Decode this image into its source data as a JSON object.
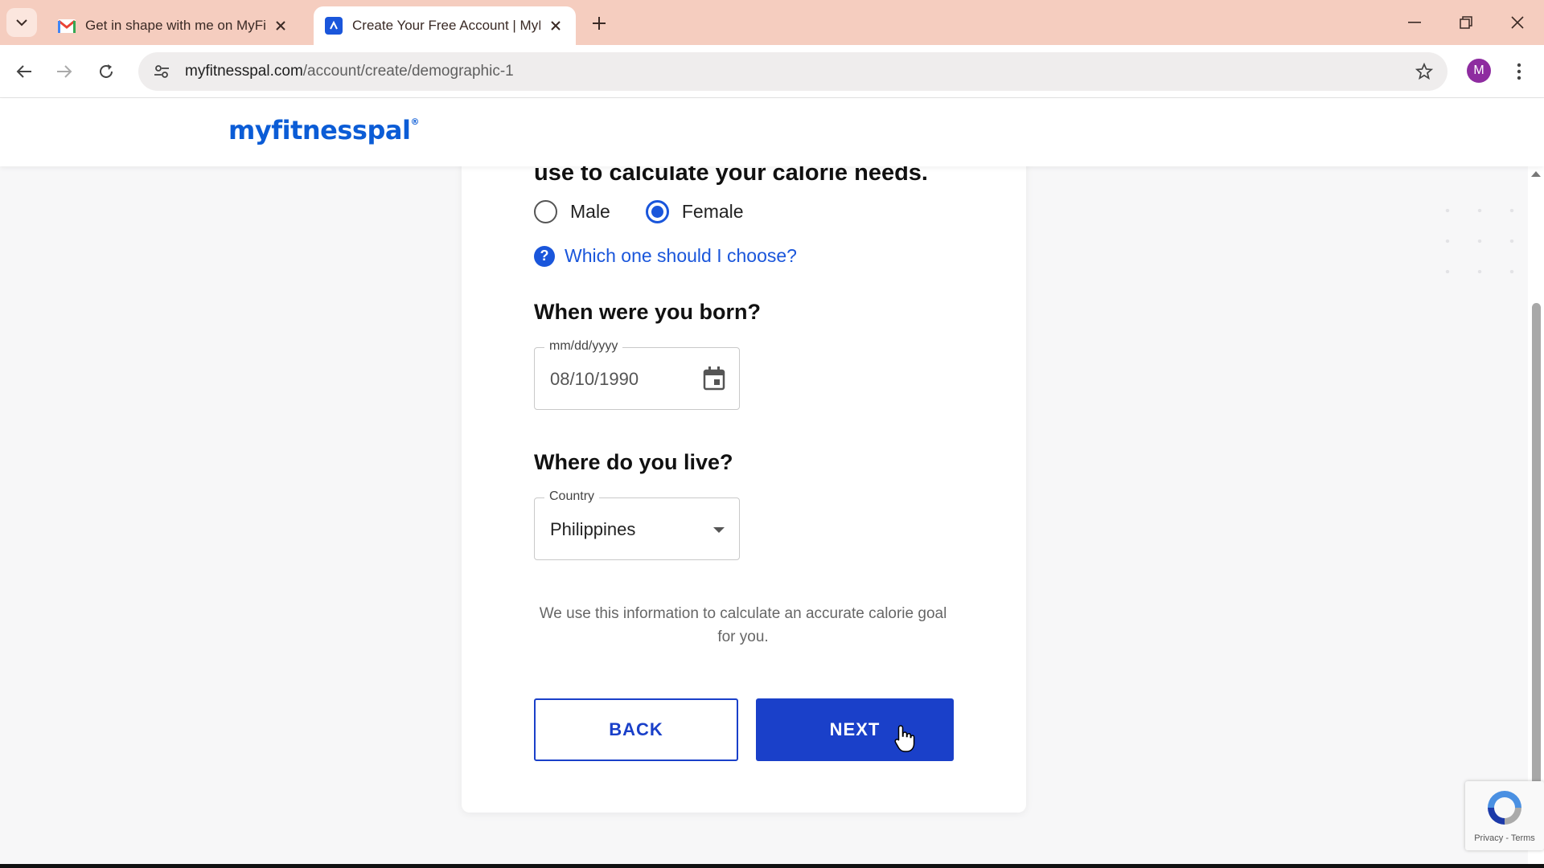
{
  "browser": {
    "tabs": [
      {
        "title": "Get in shape with me on MyFit",
        "favicon": "gmail-icon",
        "active": false
      },
      {
        "title": "Create Your Free Account | MyF",
        "favicon": "myfitnesspal-icon",
        "active": true
      }
    ],
    "url_host": "myfitnesspal.com",
    "url_path": "/account/create/demographic-1",
    "profile_initial": "M"
  },
  "site": {
    "logo": "myfitnesspal",
    "logo_mark": "®"
  },
  "form": {
    "clipped_heading": "use to calculate your calorie needs.",
    "sex_options": [
      {
        "label": "Male",
        "selected": false
      },
      {
        "label": "Female",
        "selected": true
      }
    ],
    "help_link": "Which one should I choose?",
    "birth": {
      "title": "When were you born?",
      "legend": "mm/dd/yyyy",
      "value": "08/10/1990"
    },
    "country": {
      "title": "Where do you live?",
      "legend": "Country",
      "value": "Philippines"
    },
    "info": "We use this information to calculate an accurate calorie goal for you.",
    "back_label": "BACK",
    "next_label": "NEXT"
  },
  "recaptcha": {
    "text": "Privacy - Terms"
  },
  "colors": {
    "accent": "#1a40c9",
    "link": "#1a56db",
    "tabstrip": "#f5cdbf",
    "logo": "#0b5cd6"
  }
}
